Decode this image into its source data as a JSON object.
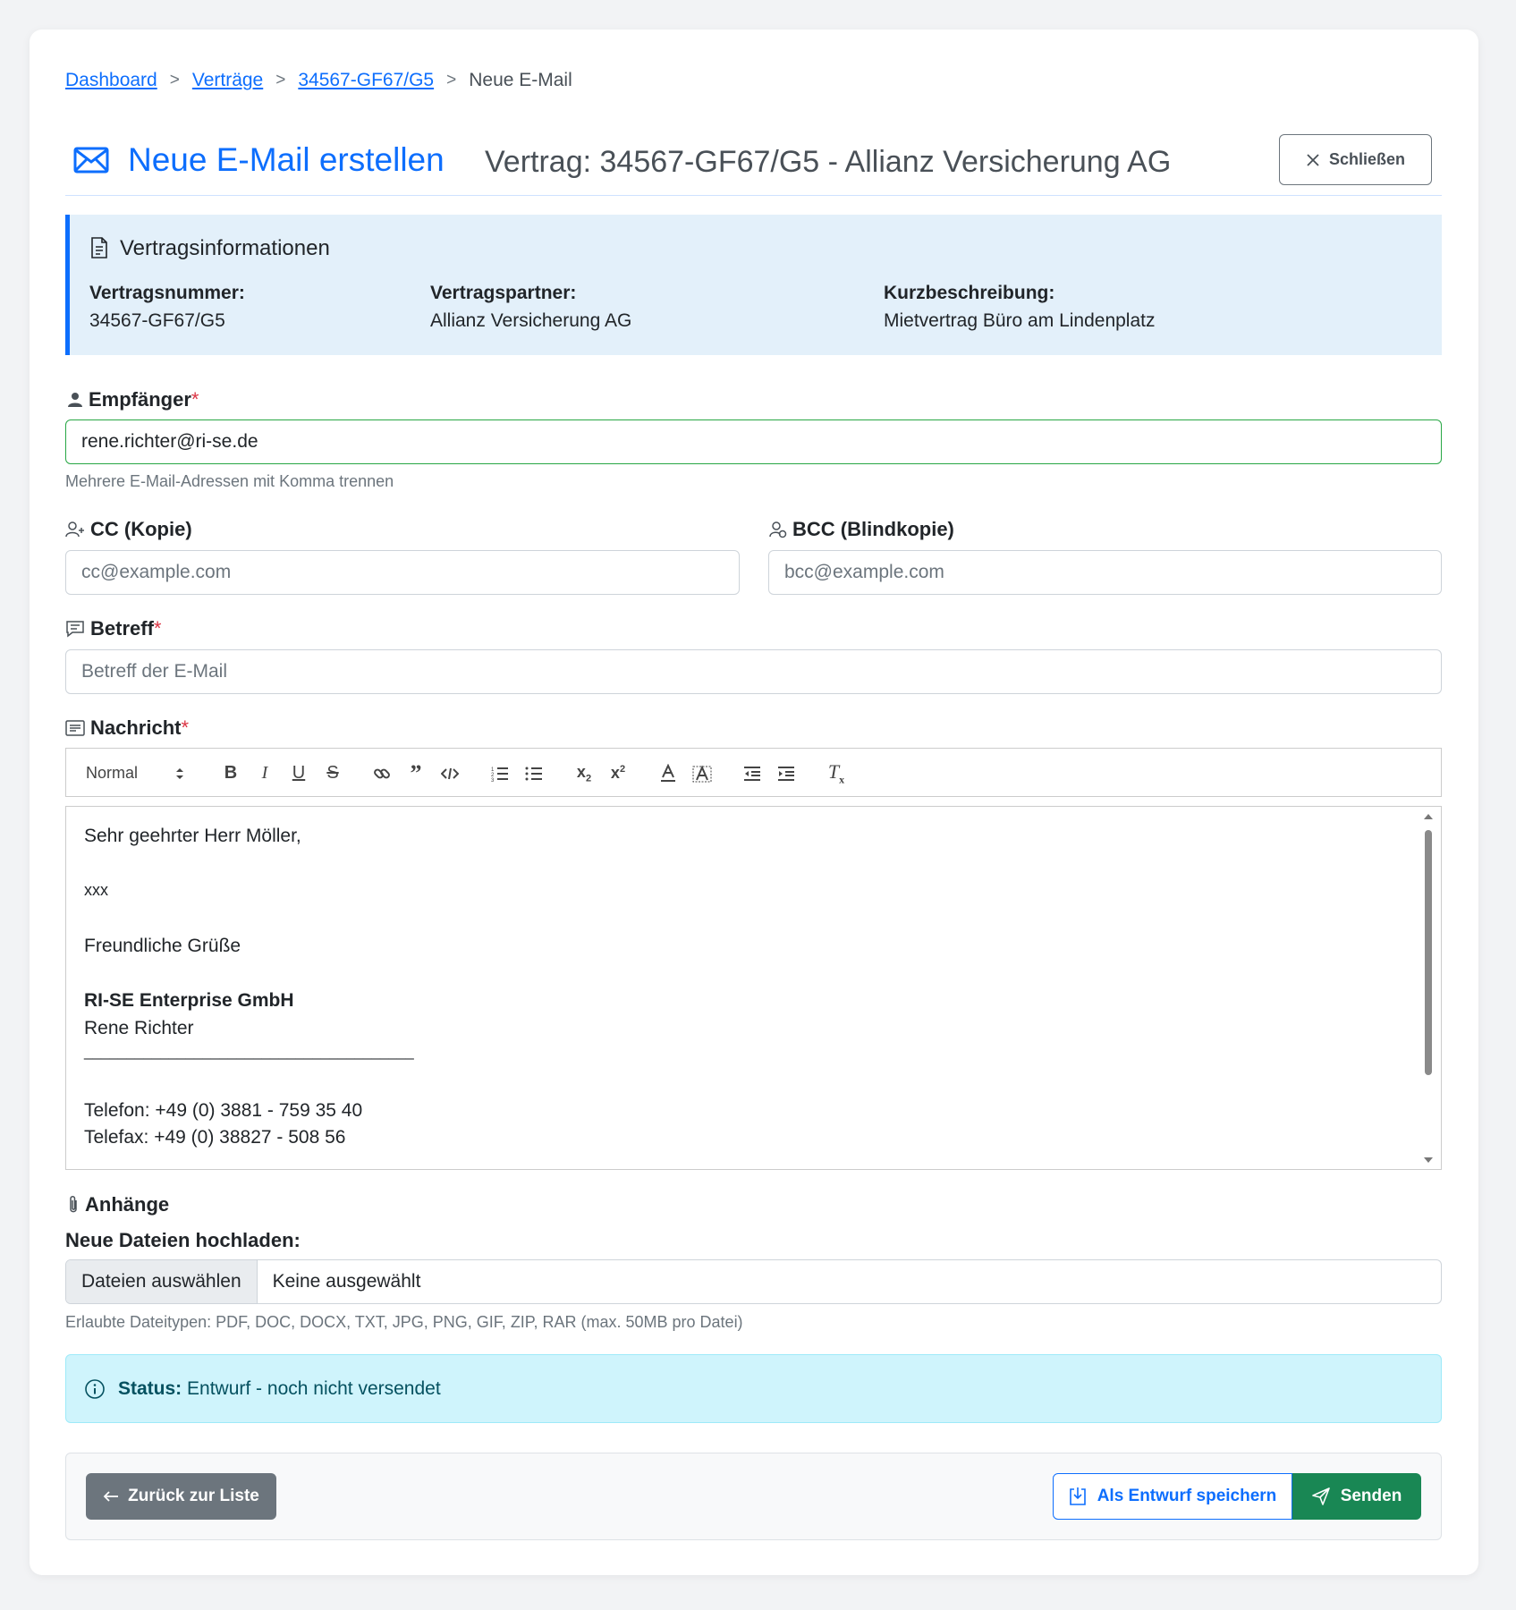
{
  "breadcrumb": {
    "items": [
      "Dashboard",
      "Verträge",
      "34567-GF67/G5"
    ],
    "current": "Neue E-Mail",
    "separator": ">"
  },
  "header": {
    "title": "Neue E-Mail erstellen",
    "subtitle": "Vertrag: 34567-GF67/G5 - Allianz Versicherung AG",
    "close_label": "Schließen"
  },
  "info": {
    "title": "Vertragsinformationen",
    "fields": [
      {
        "label": "Vertragsnummer:",
        "value": "34567-GF67/G5"
      },
      {
        "label": "Vertragspartner:",
        "value": "Allianz Versicherung AG"
      },
      {
        "label": "Kurzbeschreibung:",
        "value": "Mietvertrag Büro am Lindenplatz"
      }
    ]
  },
  "form": {
    "recipient": {
      "label": "Empfänger",
      "required_mark": "*",
      "value": "rene.richter@ri-se.de",
      "hint": "Mehrere E-Mail-Adressen mit Komma trennen"
    },
    "cc": {
      "label": "CC (Kopie)",
      "placeholder": "cc@example.com"
    },
    "bcc": {
      "label": "BCC (Blindkopie)",
      "placeholder": "bcc@example.com"
    },
    "subject": {
      "label": "Betreff",
      "required_mark": "*",
      "placeholder": "Betreff der E-Mail"
    },
    "message": {
      "label": "Nachricht",
      "required_mark": "*",
      "format_select": "Normal",
      "lines": {
        "greeting": "Sehr geehrter Herr Möller,",
        "body": "xxx",
        "closing": "Freundliche Grüße",
        "company": "RI-SE Enterprise GmbH",
        "name": "Rene Richter",
        "divider": "_______________________________________",
        "phone": "Telefon: +49 (0) 3881 - 759 35 40",
        "fax": "Telefax: +49 (0) 38827 - 508 56"
      }
    }
  },
  "attachments": {
    "label": "Anhänge",
    "upload_label": "Neue Dateien hochladen:",
    "choose_button": "Dateien auswählen",
    "no_file": "Keine ausgewählt",
    "hint": "Erlaubte Dateitypen: PDF, DOC, DOCX, TXT, JPG, PNG, GIF, ZIP, RAR (max. 50MB pro Datei)"
  },
  "status": {
    "label": "Status:",
    "value": "Entwurf - noch nicht versendet"
  },
  "actions": {
    "back": "Zurück zur Liste",
    "save_draft": "Als Entwurf speichern",
    "send": "Senden"
  },
  "colors": {
    "primary": "#0d6efd",
    "success": "#198754",
    "secondary": "#6c757d",
    "info_bg": "#cff4fc"
  }
}
